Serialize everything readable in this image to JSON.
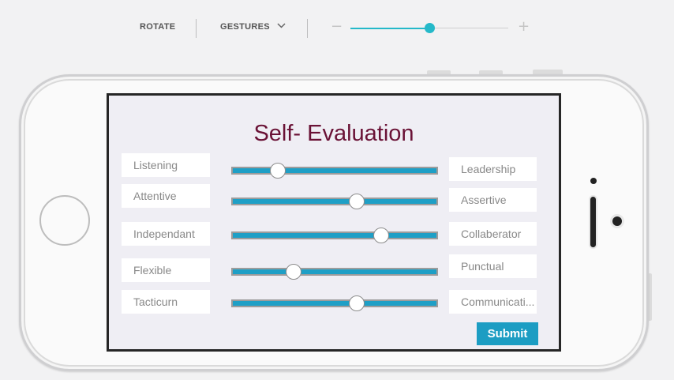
{
  "toolbar": {
    "rotate_label": "ROTATE",
    "gestures_label": "GESTURES",
    "zoom_minus": "−",
    "zoom_plus": "+",
    "zoom_level": 0.5
  },
  "screen": {
    "title": "Self- Evaluation",
    "rows": [
      {
        "left": "Listening",
        "right": "Leadership",
        "value": 0.22
      },
      {
        "left": "Attentive",
        "right": "Assertive",
        "value": 0.61
      },
      {
        "left": "Independant",
        "right": "Collaberator",
        "value": 0.73
      },
      {
        "left": "Flexible",
        "right": "Punctual",
        "value": 0.3
      },
      {
        "left": "Tacticurn",
        "right": "Communicati...",
        "value": 0.61
      }
    ],
    "submit_label": "Submit"
  },
  "colors": {
    "title": "#6a1236",
    "slider_fill": "#1e9fc6",
    "submit_bg": "#1c9dc3",
    "zoom_accent": "#25b9c9"
  }
}
